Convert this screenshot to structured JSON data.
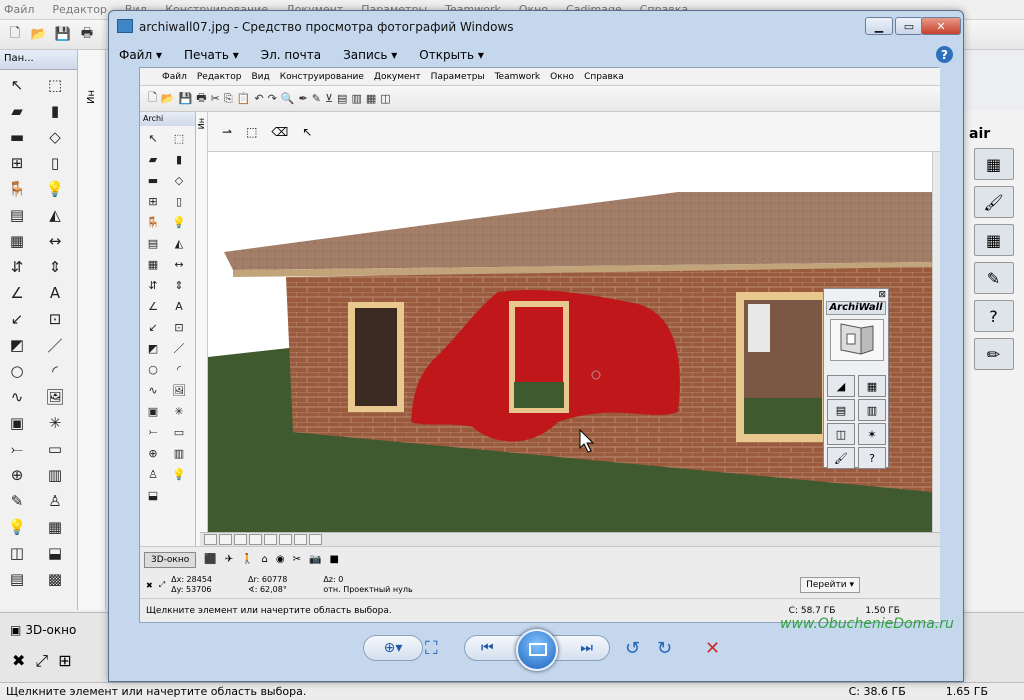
{
  "bg": {
    "menu": [
      "Файл",
      "Редактор",
      "Вид",
      "Конструирование",
      "Документ",
      "Параметры",
      "Teamwork",
      "Окно",
      "Cadimage",
      "Справка"
    ],
    "palette_title": "Пан...",
    "strip_label": "Ин",
    "tab_3d": "3D-окно",
    "status_text": "Щелкните элемент или начертите область выбора.",
    "disk_free": "С: 38.6 ГБ",
    "ram": "1.65 ГБ",
    "right_panel_label": "air"
  },
  "viewer": {
    "title": "archiwall07.jpg - Средство просмотра фотографий Windows",
    "menu": [
      {
        "label": "Файл ▾"
      },
      {
        "label": "Печать ▾"
      },
      {
        "label": "Эл. почта"
      },
      {
        "label": "Запись ▾"
      },
      {
        "label": "Открыть ▾"
      }
    ],
    "help": "?"
  },
  "inner": {
    "menu": [
      "Файл",
      "Редактор",
      "Вид",
      "Конструирование",
      "Документ",
      "Параметры",
      "Teamwork",
      "Окно",
      "Справка"
    ],
    "palette_title": "Archi",
    "strip_label": "Ин",
    "tab_3d": "3D-окно",
    "dx_label": "Δx: 28454",
    "dy_label": "Δy: 53706",
    "dr_label": "Δr: 60778",
    "angle_label": "∢: 62,08°",
    "dz_label": "Δz: 0",
    "zero_label": "отн. Проектный нуль",
    "goto": "Перейти ▾",
    "status_text": "Щелкните элемент или начертите область выбора.",
    "disk_free": "С: 58.7 ГБ",
    "ram": "1.50 ГБ"
  },
  "archiwall": {
    "title": "ArchiWall",
    "close": "⊠"
  },
  "watermark": "www.ObuchenieDoma.ru",
  "colors": {
    "brick": "#9a5a3e",
    "roof": "#a27e69",
    "grass": "#3e5a2e",
    "car_shape": "#c0171b",
    "window_frame": "#e8c88f"
  }
}
